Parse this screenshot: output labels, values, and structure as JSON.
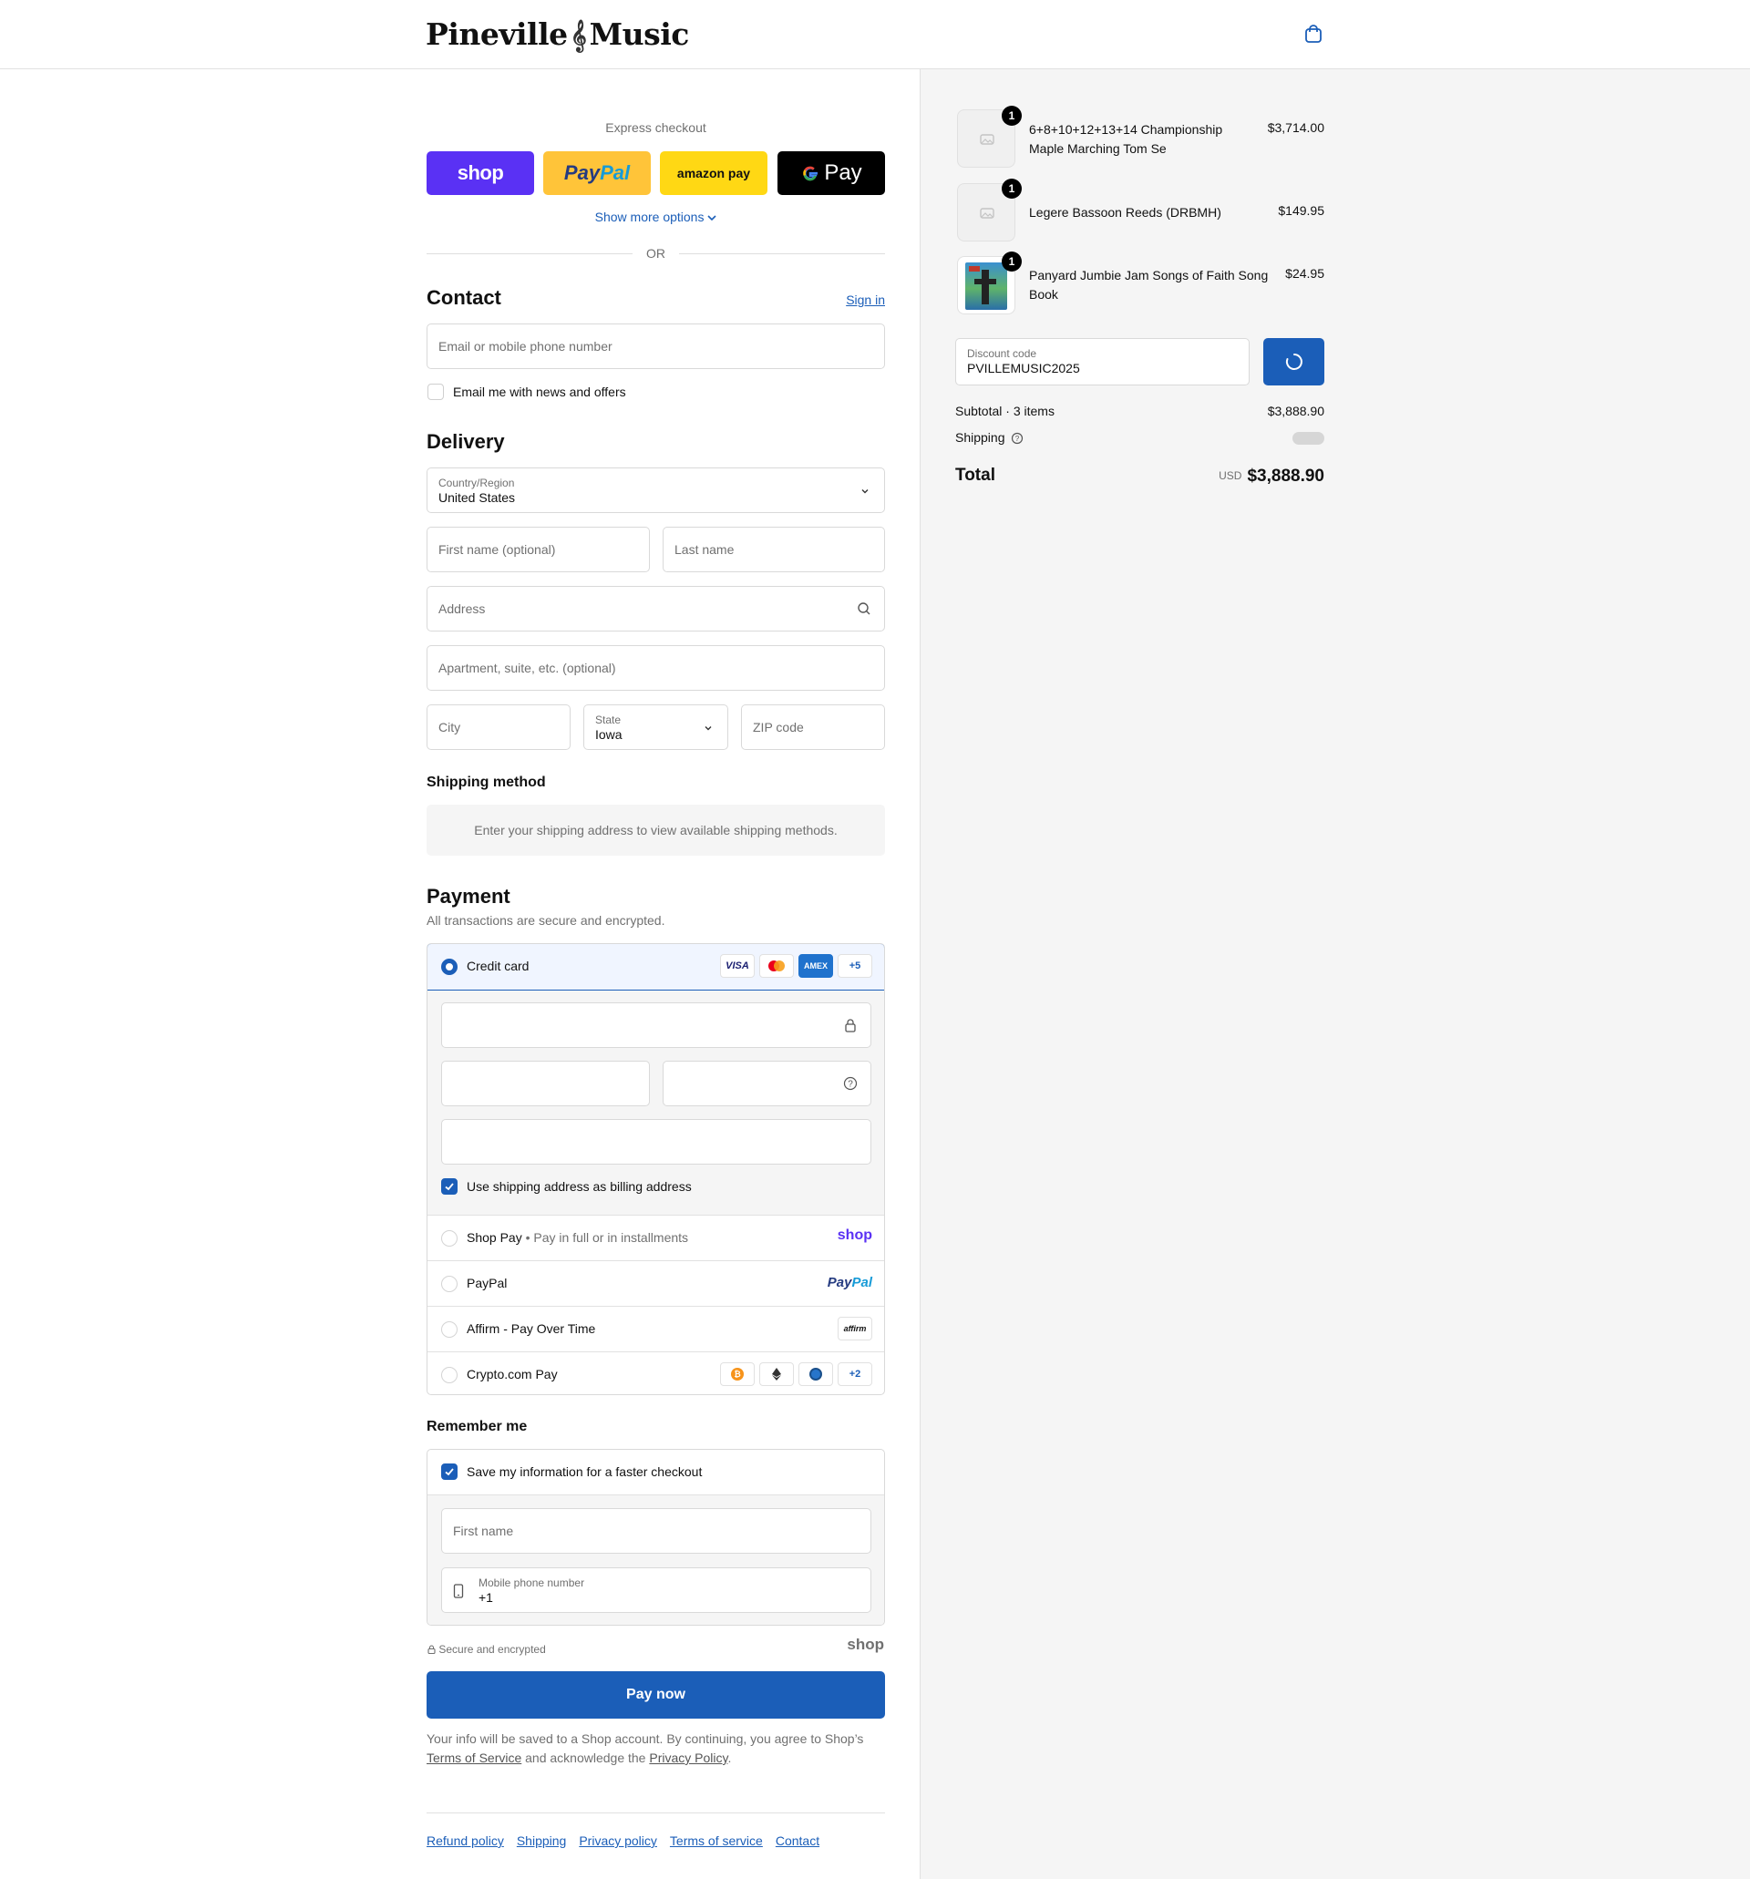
{
  "header": {
    "logo_left": "Pineville",
    "logo_right": "Music"
  },
  "express": {
    "label": "Express checkout",
    "shop_label": "shop",
    "paypal_label_a": "Pay",
    "paypal_label_b": "Pal",
    "amazon_label": "amazon pay",
    "gpay_label": "Pay",
    "more_options": "Show more options",
    "or": "OR"
  },
  "contact": {
    "title": "Contact",
    "sign_in": "Sign in",
    "email_placeholder": "Email or mobile phone number",
    "news_label": "Email me with news and offers"
  },
  "delivery": {
    "title": "Delivery",
    "country_label": "Country/Region",
    "country_value": "United States",
    "first_name_ph": "First name (optional)",
    "last_name_ph": "Last name",
    "address_ph": "Address",
    "apartment_ph": "Apartment, suite, etc. (optional)",
    "city_ph": "City",
    "state_label": "State",
    "state_value": "Iowa",
    "zip_ph": "ZIP code"
  },
  "shipping_method": {
    "title": "Shipping method",
    "notice": "Enter your shipping address to view available shipping methods."
  },
  "payment": {
    "title": "Payment",
    "subtitle": "All transactions are secure and encrypted.",
    "credit_card": "Credit card",
    "card_badges": [
      "VISA",
      "",
      "AMEX",
      "+5"
    ],
    "billing_label": "Use shipping address as billing address",
    "shop_pay": "Shop Pay",
    "shop_pay_note": "Pay in full or in installments",
    "shop_pay_logo": "shop",
    "paypal": "PayPal",
    "paypal_logo_a": "Pay",
    "paypal_logo_b": "Pal",
    "affirm": "Affirm - Pay Over Time",
    "affirm_logo": "affirm",
    "crypto": "Crypto.com Pay",
    "crypto_more": "+2"
  },
  "remember": {
    "title": "Remember me",
    "save_label": "Save my information for a faster checkout",
    "first_name_ph": "First name",
    "phone_label": "Mobile phone number",
    "phone_value": "+1",
    "secure_label": "Secure and encrypted",
    "shop_logo": "shop"
  },
  "pay_now": "Pay now",
  "legal": {
    "text_a": "Your info will be saved to a Shop account. By continuing, you agree to Shop’s",
    "terms": "Terms of Service",
    "text_b": "and acknowledge the",
    "privacy": "Privacy Policy",
    "text_c": "."
  },
  "footer_links": [
    "Refund policy",
    "Shipping",
    "Privacy policy",
    "Terms of service",
    "Contact"
  ],
  "order": {
    "items": [
      {
        "qty": "1",
        "name": "6+8+10+12+13+14 Championship Maple Marching Tom Se",
        "price": "$3,714.00"
      },
      {
        "qty": "1",
        "name": "Legere Bassoon Reeds (DRBMH)",
        "price": "$149.95"
      },
      {
        "qty": "1",
        "name": "Panyard Jumbie Jam Songs of Faith Song Book",
        "price": "$24.95"
      }
    ],
    "discount_label": "Discount code",
    "discount_value": "PVILLEMUSIC2025",
    "subtotal_label": "Subtotal · 3 items",
    "subtotal_value": "$3,888.90",
    "shipping_label": "Shipping",
    "total_label": "Total",
    "currency": "USD",
    "total_value": "$3,888.90"
  },
  "colors": {
    "accent": "#1b5eb8",
    "shop_purple": "#5a31f4",
    "paypal_yellow": "#ffc439",
    "amazon_yellow": "#ffd814",
    "right_bg": "#f5f5f5"
  }
}
